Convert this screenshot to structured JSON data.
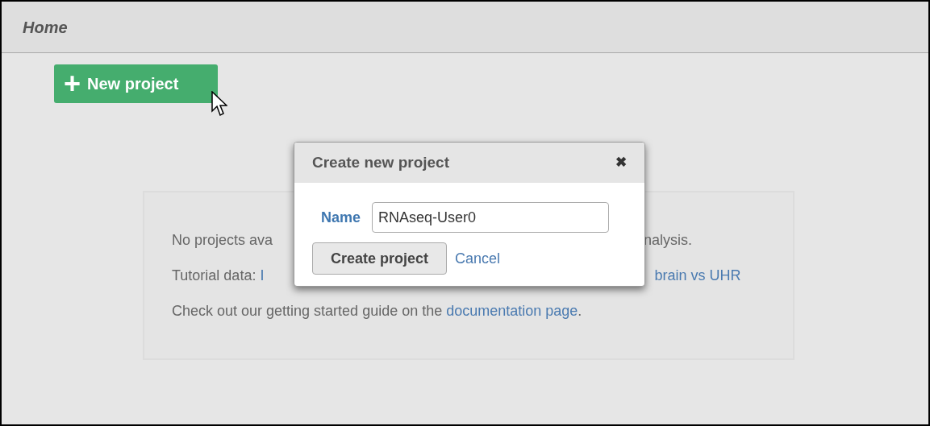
{
  "header": {
    "title": "Home"
  },
  "new_project_button": {
    "icon": "+",
    "label": "New project"
  },
  "empty_state": {
    "lines": [
      {
        "parts": [
          {
            "text": "No projects ava",
            "link": false
          },
          {
            "text": "nalysis.",
            "link": false
          }
        ]
      },
      {
        "parts": [
          {
            "text": "Tutorial data: ",
            "link": false
          },
          {
            "text": "I",
            "link": true
          },
          {
            "text": "brain vs UHR",
            "link": true
          }
        ]
      },
      {
        "parts": [
          {
            "text": "Check out our getting started guide on the ",
            "link": false
          },
          {
            "text": "documentation page",
            "link": true
          },
          {
            "text": ".",
            "link": false
          }
        ]
      }
    ]
  },
  "dialog": {
    "title": "Create new project",
    "close": "✖",
    "field_label": "Name",
    "field_value": "RNAseq-User0",
    "buttons": [
      {
        "label": "Create project",
        "kind": "button"
      },
      {
        "label": "Cancel",
        "kind": "link"
      }
    ]
  }
}
